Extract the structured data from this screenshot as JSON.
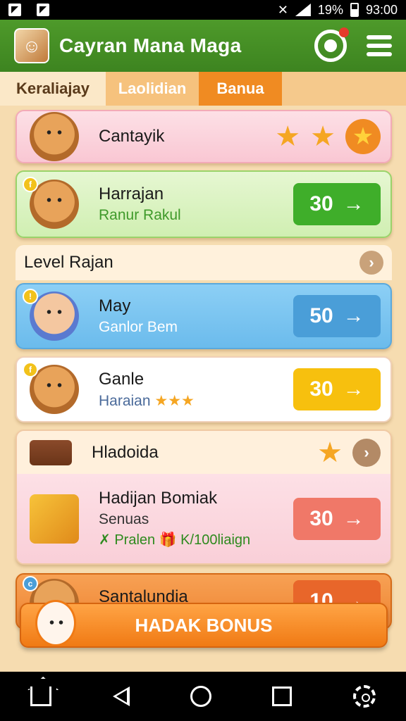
{
  "status_bar": {
    "battery": "19%",
    "time": "93:00"
  },
  "app": {
    "title": "Cayran Mana Maga"
  },
  "tabs": [
    {
      "label": "Keraliajay"
    },
    {
      "label": "Laolidian"
    },
    {
      "label": "Banua"
    }
  ],
  "items": [
    {
      "name": "Cantayik",
      "stars": 3
    },
    {
      "name": "Harrajan",
      "subtitle": "Ranur Rakul",
      "badge": "f",
      "value": "30",
      "arrow": "→"
    },
    {
      "section": "Level Rajan"
    },
    {
      "name": "May",
      "subtitle": "Ganlor Bem",
      "badge": "!",
      "value": "50",
      "arrow": "→"
    },
    {
      "name": "Ganle",
      "subtitle": "Haraian",
      "badge": "f",
      "value": "30",
      "arrow": "→"
    },
    {
      "header": "Hladoida",
      "name": "Hadijan Bomiak",
      "subtitle": "Senuas",
      "extra": "Pralen",
      "extra2": "K/100liaign",
      "value": "30",
      "arrow": "→"
    },
    {
      "name": "Santalundia",
      "badge": "c",
      "value": "10",
      "arrow": "→"
    }
  ],
  "bonus": {
    "label": "HADAK BONUS"
  },
  "colors": {
    "appbar": "#4e9a2a",
    "tab_active": "#f08b22",
    "green_btn": "#3fae2a",
    "blue_btn": "#4a9ed8",
    "yellow_btn": "#f7c00e",
    "pink_btn": "#f07868"
  }
}
